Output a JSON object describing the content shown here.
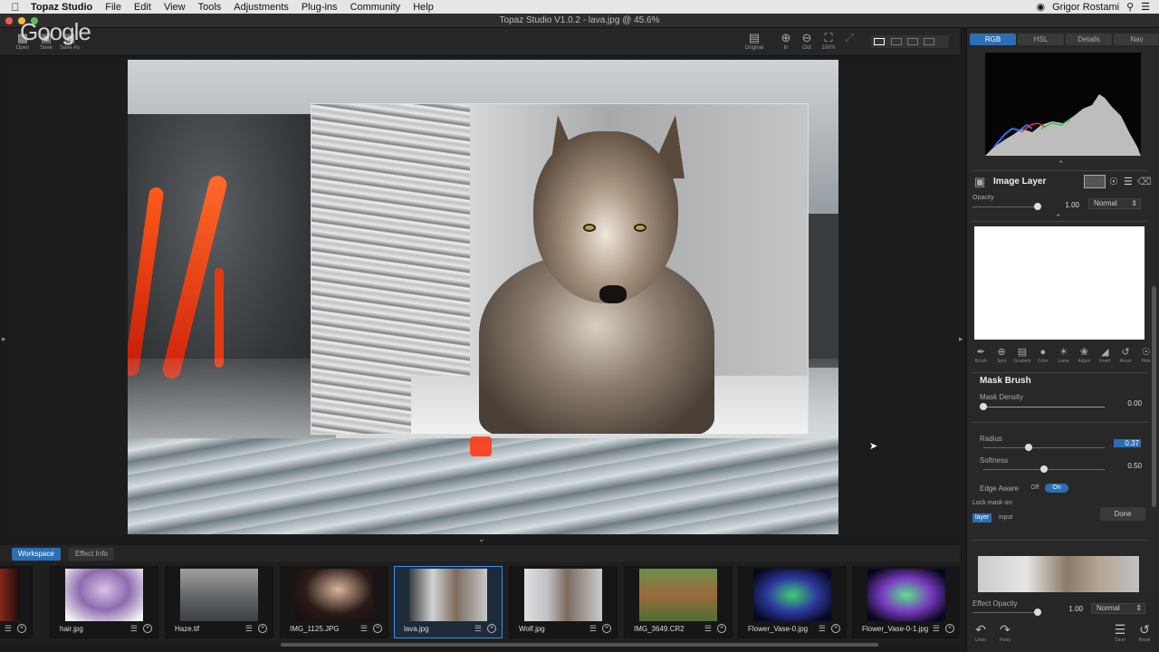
{
  "menubar": {
    "app_name": "Topaz Studio",
    "items": [
      "File",
      "Edit",
      "View",
      "Tools",
      "Adjustments",
      "Plug-ins",
      "Community",
      "Help"
    ],
    "user": "Grigor Rostami"
  },
  "window": {
    "title": "Topaz Studio V1.0.2 - lava.jpg @ 45.6%",
    "watermark": "Google"
  },
  "toolbar": {
    "open_label": "Open",
    "save_label": "Save",
    "save_as_label": "Save As",
    "original_label": "Original",
    "zoom_in_label": "In",
    "zoom_out_label": "Out",
    "fit_label": "100%"
  },
  "workspace": {
    "tabs": [
      "Workspace",
      "Effect Info"
    ],
    "active_tab": "Workspace"
  },
  "filmstrip": {
    "items": [
      {
        "label": "hair.jpg",
        "selected": false
      },
      {
        "label": "Haze.tif",
        "selected": false
      },
      {
        "label": "IMG_1125.JPG",
        "selected": false
      },
      {
        "label": "lava.jpg",
        "selected": true
      },
      {
        "label": "Wolf.jpg",
        "selected": false
      },
      {
        "label": "IMG_3649.CR2",
        "selected": false
      },
      {
        "label": "Flower_Vase-0.jpg",
        "selected": false
      },
      {
        "label": "Flower_Vase-0-1.jpg",
        "selected": false
      }
    ]
  },
  "panel": {
    "tabs": [
      "RGB",
      "HSL",
      "Details",
      "Nav"
    ],
    "active_tab": "RGB",
    "layer": {
      "title": "Image Layer",
      "opacity_label": "Opacity",
      "opacity_value": "1.00",
      "opacity": 1.0,
      "blend_mode": "Normal"
    },
    "mask_tools": [
      "Brush",
      "Spot",
      "Gradient",
      "Color",
      "Luma",
      "Adjust",
      "Invert",
      "Reset",
      "Hide"
    ],
    "mask_brush": {
      "title": "Mask Brush",
      "density_label": "Mask Density",
      "density_value": "0.00",
      "density": 0.0,
      "radius_label": "Radius",
      "radius_value": "0.37",
      "radius": 0.37,
      "softness_label": "Softness",
      "softness_value": "0.50",
      "softness": 0.5,
      "edge_aware_label": "Edge Aware",
      "edge_off": "Off",
      "edge_on": "On",
      "edge_aware": true,
      "lock_label": "Lock mask on:",
      "lock_layer": "layer",
      "lock_input": "input",
      "done_label": "Done"
    },
    "effect_opacity": {
      "label": "Effect Opacity",
      "value": "1.00",
      "opacity": 1.0,
      "blend_mode": "Normal"
    },
    "bottom": {
      "undo": "Undo",
      "redo": "Redo",
      "save": "Save",
      "reset": "Reset"
    }
  },
  "colors": {
    "accent": "#2d6fb4",
    "selection": "#3c8ff0"
  }
}
